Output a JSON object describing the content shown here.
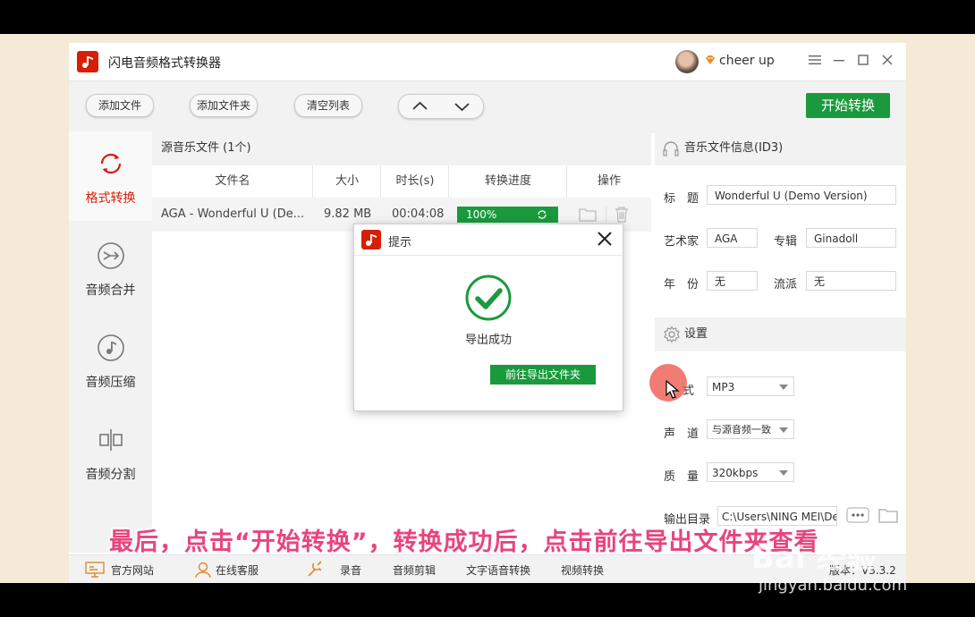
{
  "app": {
    "title": "闪电音频格式转换器",
    "user_name": "cheer up",
    "version": "版本：V3.3.2"
  },
  "toolbar": {
    "add_file": "添加文件",
    "add_folder": "添加文件夹",
    "clear_list": "清空列表",
    "start_convert": "开始转换"
  },
  "sidebar": {
    "items": [
      {
        "label": "格式转换",
        "icon": "refresh-cycle-icon",
        "active": true
      },
      {
        "label": "音频合并",
        "icon": "merge-arrows-icon",
        "active": false
      },
      {
        "label": "音频压缩",
        "icon": "music-note-icon",
        "active": false
      },
      {
        "label": "音频分割",
        "icon": "split-icon",
        "active": false
      }
    ]
  },
  "file_list": {
    "header": "源音乐文件 (1个)",
    "columns": [
      "文件名",
      "大小",
      "时长(s)",
      "转换进度",
      "操作"
    ],
    "rows": [
      {
        "name": "AGA - Wonderful U (De...",
        "size": "9.82 MB",
        "duration": "00:04:08",
        "progress": "100%"
      }
    ]
  },
  "id3": {
    "header": "音乐文件信息(ID3)",
    "title_label": "标　题",
    "title_value": "Wonderful U (Demo Version)",
    "artist_label": "艺术家",
    "artist_value": "AGA",
    "album_label": "专辑",
    "album_value": "Ginadoll",
    "year_label": "年　份",
    "year_value": "无",
    "genre_label": "流派",
    "genre_value": "无"
  },
  "settings": {
    "header": "设置",
    "format_label": "式",
    "format_value": "MP3",
    "channel_label": "声　道",
    "channel_value": "与源音频一致",
    "quality_label": "质　量",
    "quality_value": "320kbps",
    "output_label": "输出目录",
    "output_value": "C:\\Users\\NING MEI\\De"
  },
  "footer": {
    "website": "官方网站",
    "support": "在线客服",
    "record": "录音",
    "audio_edit": "音频剪辑",
    "tts": "文字语音转换",
    "video_convert": "视频转换"
  },
  "dialog": {
    "title": "提示",
    "message": "导出成功",
    "open_folder": "前往导出文件夹"
  },
  "overlay": {
    "caption": "最后，点击“开始转换”，转换成功后，点击前往导出文件夹查看",
    "watermark_logo": "Bai 经验",
    "watermark_url": "jingyan.baidu.com"
  },
  "colors": {
    "accent_green": "#1a9a3c",
    "brand_red": "#d81e06",
    "caption_pink": "#e8457c"
  }
}
